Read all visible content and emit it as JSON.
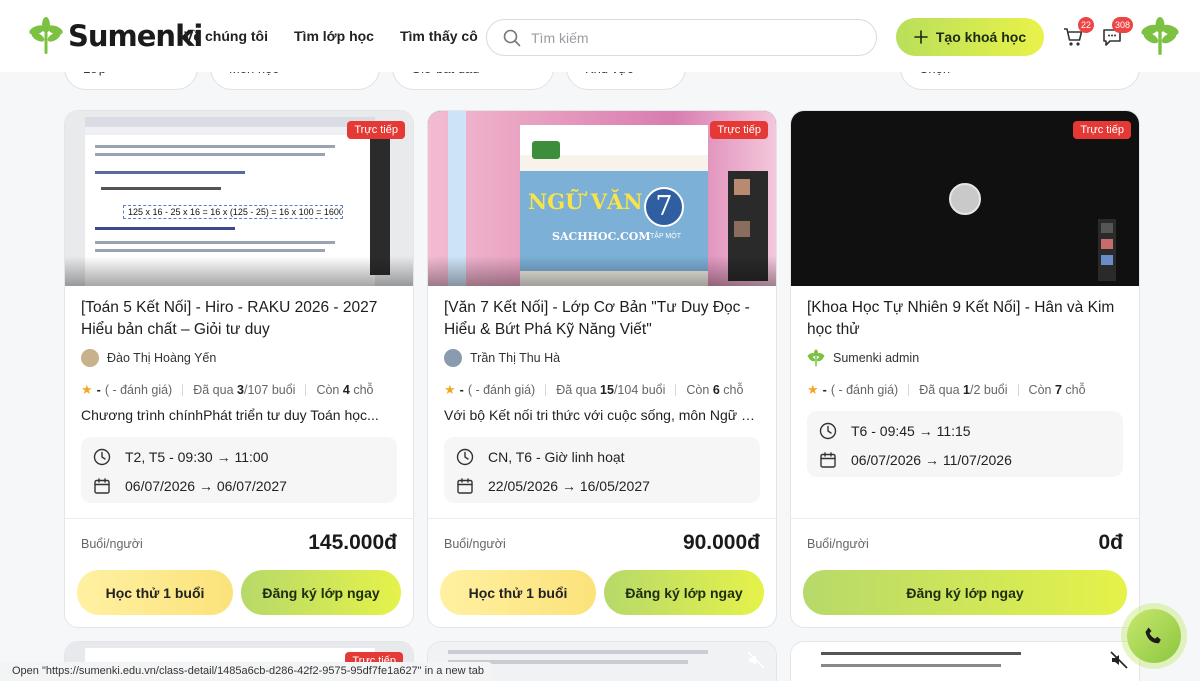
{
  "header": {
    "logo_text": "Sumenki",
    "nav": [
      "Về chúng tôi",
      "Tìm lớp học",
      "Tìm thấy cô"
    ],
    "search_placeholder": "Tìm kiếm",
    "create_label": "Tạo khoá học",
    "cart_count": "22",
    "chat_count": "308"
  },
  "filters": [
    "Lớp",
    "Môn học",
    "Giờ bắt đầu",
    "Khu vực",
    "Chọn"
  ],
  "live_label": "Trực tiếp",
  "unit_label": "Buổi/người",
  "trial_label": "Học thử 1 buổi",
  "register_label": "Đăng ký lớp ngay",
  "rating_dash": "-",
  "rating_text": "( - đánh giá)",
  "passed_prefix": "Đã qua",
  "passed_suffix": "buổi",
  "remain_prefix": "Còn",
  "remain_suffix": "chỗ",
  "cards": [
    {
      "title": "[Toán 5 Kết Nối] - Hiro - RAKU 2026 - 2027 Hiểu bản chất – Giỏi tư duy",
      "teacher": "Đào Thị Hoàng Yến",
      "passed": "3",
      "total": "/107",
      "remain": "4",
      "desc": "Chương trình chínhPhát triển tư duy Toán học...",
      "schedule": "T2, T5 - 09:30 → 11:00",
      "dates": "06/07/2026 → 06/07/2027",
      "price": "145.000đ",
      "thumb_math": "125 x 16 - 25 x 16 = 16 x (125 - 25) = 16 x 100 = 1600"
    },
    {
      "title": "[Văn 7 Kết Nối] - Lớp Cơ Bản \"Tư Duy Đọc - Hiểu & Bứt Phá Kỹ Năng Viết\"",
      "teacher": "Trần Thị Thu Hà",
      "passed": "15",
      "total": "/104",
      "remain": "6",
      "desc": "Với bộ Kết nối tri thức với cuộc sống, môn Ngữ vă...",
      "schedule": "CN, T6 - Giờ linh hoạt",
      "dates": "22/05/2026 → 16/05/2027",
      "price": "90.000đ",
      "thumb_title": "NGỮ VĂN",
      "thumb_site": "SACHHOC.COM",
      "thumb_num": "7",
      "thumb_sub": "TẬP MỘT"
    },
    {
      "title": "[Khoa Học Tự Nhiên 9 Kết Nối] - Hân và Kim học thử",
      "teacher": "Sumenki admin",
      "passed": "1",
      "total": "/2",
      "remain": "7",
      "schedule": "T6 - 09:45 → 11:15",
      "dates": "06/07/2026 → 11/07/2026",
      "price": "0đ"
    }
  ],
  "status_url": "Open \"https://sumenki.edu.vn/class-detail/1485a6cb-d286-42f2-9575-95df7fe1a627\" in a new tab",
  "colors": {
    "live": "#e53935",
    "accent": "#b9df5a",
    "logo_green": "#7cc142"
  }
}
